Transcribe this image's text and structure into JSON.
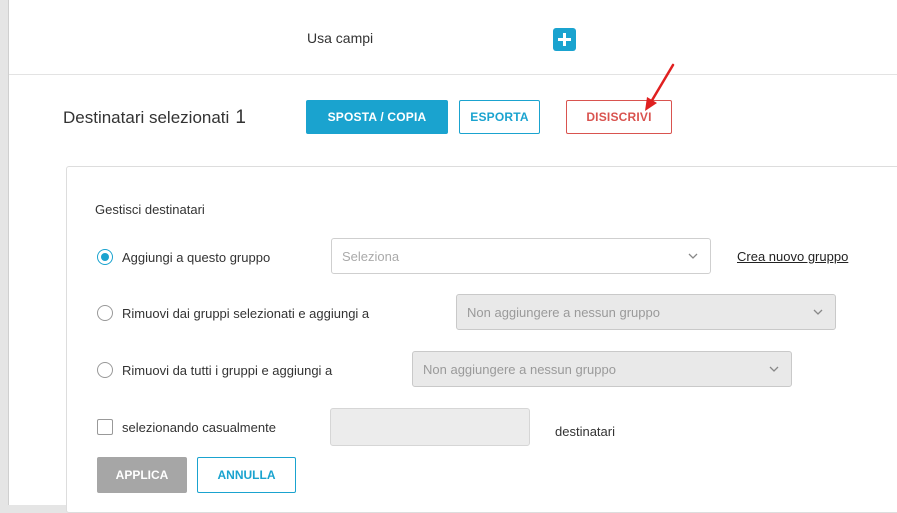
{
  "header": {
    "use_fields_label": "Usa campi",
    "add_icon": "plus-icon"
  },
  "selection": {
    "title": "Destinatari selezionati",
    "count": "1"
  },
  "actions": {
    "move_copy_label": "SPOSTA / COPIA",
    "export_label": "ESPORTA",
    "unsubscribe_label": "DISISCRIVI"
  },
  "annotation": {
    "arrow_color": "#e02020"
  },
  "manage": {
    "title": "Gestisci destinatari",
    "option_add": {
      "label": "Aggiungi a questo gruppo",
      "selected": true,
      "select_placeholder": "Seleziona",
      "create_group_link": "Crea nuovo gruppo"
    },
    "option_remove_selected": {
      "label": "Rimuovi dai gruppi selezionati e aggiungi a",
      "selected": false,
      "select_value": "Non aggiungere a nessun gruppo"
    },
    "option_remove_all": {
      "label": "Rimuovi da tutti i gruppi e aggiungi a",
      "selected": false,
      "select_value": "Non aggiungere a nessun gruppo"
    },
    "random": {
      "label": "selezionando casualmente",
      "checked": false,
      "input_value": "",
      "suffix": "destinatari"
    },
    "apply_label": "APPLICA",
    "cancel_label": "ANNULLA"
  },
  "colors": {
    "accent": "#1aa3cf",
    "danger": "#d9534f",
    "disabled_button": "#a6a6a6"
  }
}
